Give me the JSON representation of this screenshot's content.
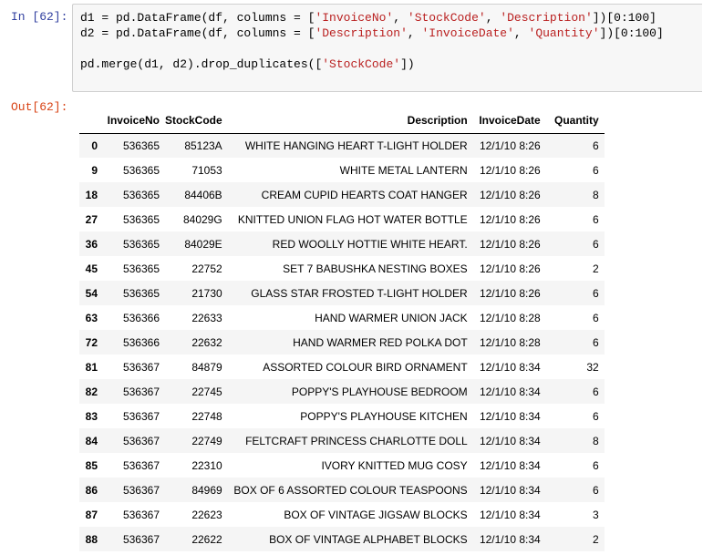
{
  "cell": {
    "in_prompt": "In [62]:",
    "out_prompt": "Out[62]:",
    "code_lines": [
      [
        {
          "t": "d1 = pd.DataFrame(df, columns = [",
          "c": "plain"
        },
        {
          "t": "'InvoiceNo'",
          "c": "str"
        },
        {
          "t": ", ",
          "c": "plain"
        },
        {
          "t": "'StockCode'",
          "c": "str"
        },
        {
          "t": ", ",
          "c": "plain"
        },
        {
          "t": "'Description'",
          "c": "str"
        },
        {
          "t": "])[0:100]",
          "c": "plain"
        }
      ],
      [
        {
          "t": "d2 = pd.DataFrame(df, columns = [",
          "c": "plain"
        },
        {
          "t": "'Description'",
          "c": "str"
        },
        {
          "t": ", ",
          "c": "plain"
        },
        {
          "t": "'InvoiceDate'",
          "c": "str"
        },
        {
          "t": ", ",
          "c": "plain"
        },
        {
          "t": "'Quantity'",
          "c": "str"
        },
        {
          "t": "])[0:100]",
          "c": "plain"
        }
      ],
      [],
      [
        {
          "t": "pd.merge(d1, d2).drop_duplicates([",
          "c": "plain"
        },
        {
          "t": "'StockCode'",
          "c": "str"
        },
        {
          "t": "])",
          "c": "plain"
        }
      ]
    ]
  },
  "table": {
    "columns": [
      "",
      "InvoiceNo",
      "StockCode",
      "Description",
      "InvoiceDate",
      "Quantity"
    ],
    "rows": [
      [
        "0",
        "536365",
        "85123A",
        "WHITE HANGING HEART T-LIGHT HOLDER",
        "12/1/10 8:26",
        "6"
      ],
      [
        "9",
        "536365",
        "71053",
        "WHITE METAL LANTERN",
        "12/1/10 8:26",
        "6"
      ],
      [
        "18",
        "536365",
        "84406B",
        "CREAM CUPID HEARTS COAT HANGER",
        "12/1/10 8:26",
        "8"
      ],
      [
        "27",
        "536365",
        "84029G",
        "KNITTED UNION FLAG HOT WATER BOTTLE",
        "12/1/10 8:26",
        "6"
      ],
      [
        "36",
        "536365",
        "84029E",
        "RED WOOLLY HOTTIE WHITE HEART.",
        "12/1/10 8:26",
        "6"
      ],
      [
        "45",
        "536365",
        "22752",
        "SET 7 BABUSHKA NESTING BOXES",
        "12/1/10 8:26",
        "2"
      ],
      [
        "54",
        "536365",
        "21730",
        "GLASS STAR FROSTED T-LIGHT HOLDER",
        "12/1/10 8:26",
        "6"
      ],
      [
        "63",
        "536366",
        "22633",
        "HAND WARMER UNION JACK",
        "12/1/10 8:28",
        "6"
      ],
      [
        "72",
        "536366",
        "22632",
        "HAND WARMER RED POLKA DOT",
        "12/1/10 8:28",
        "6"
      ],
      [
        "81",
        "536367",
        "84879",
        "ASSORTED COLOUR BIRD ORNAMENT",
        "12/1/10 8:34",
        "32"
      ],
      [
        "82",
        "536367",
        "22745",
        "POPPY'S PLAYHOUSE BEDROOM",
        "12/1/10 8:34",
        "6"
      ],
      [
        "83",
        "536367",
        "22748",
        "POPPY'S PLAYHOUSE KITCHEN",
        "12/1/10 8:34",
        "6"
      ],
      [
        "84",
        "536367",
        "22749",
        "FELTCRAFT PRINCESS CHARLOTTE DOLL",
        "12/1/10 8:34",
        "8"
      ],
      [
        "85",
        "536367",
        "22310",
        "IVORY KNITTED MUG COSY",
        "12/1/10 8:34",
        "6"
      ],
      [
        "86",
        "536367",
        "84969",
        "BOX OF 6 ASSORTED COLOUR TEASPOONS",
        "12/1/10 8:34",
        "6"
      ],
      [
        "87",
        "536367",
        "22623",
        "BOX OF VINTAGE JIGSAW BLOCKS",
        "12/1/10 8:34",
        "3"
      ],
      [
        "88",
        "536367",
        "22622",
        "BOX OF VINTAGE ALPHABET BLOCKS",
        "12/1/10 8:34",
        "2"
      ]
    ]
  },
  "colors": {
    "in_prompt": "#303f9f",
    "out_prompt": "#d84315",
    "string": "#ba2121",
    "input_bg": "#f7f7f7",
    "row_stripe": "#f5f5f5"
  }
}
